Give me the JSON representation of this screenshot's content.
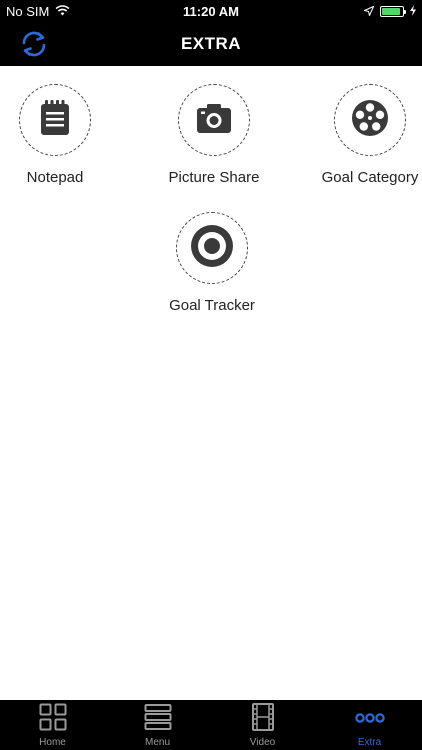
{
  "status_bar": {
    "carrier": "No SIM",
    "time": "11:20 AM",
    "battery_level": 0.9
  },
  "nav": {
    "title": "EXTRA",
    "left_icon": "sync-icon"
  },
  "items": [
    {
      "label": "Notepad",
      "icon": "notepad-icon"
    },
    {
      "label": "Picture Share",
      "icon": "camera-icon"
    },
    {
      "label": "Goal Category",
      "icon": "film-reel-icon"
    },
    {
      "label": "Goal Tracker",
      "icon": "target-icon"
    }
  ],
  "tab_bar": {
    "tabs": [
      {
        "label": "Home",
        "icon": "grid-icon"
      },
      {
        "label": "Menu",
        "icon": "menu-icon"
      },
      {
        "label": "Video",
        "icon": "film-icon"
      },
      {
        "label": "Extra",
        "icon": "more-icon"
      }
    ],
    "active": "Extra",
    "active_color": "#2f6bd8",
    "inactive_color": "#9a9a9a"
  }
}
